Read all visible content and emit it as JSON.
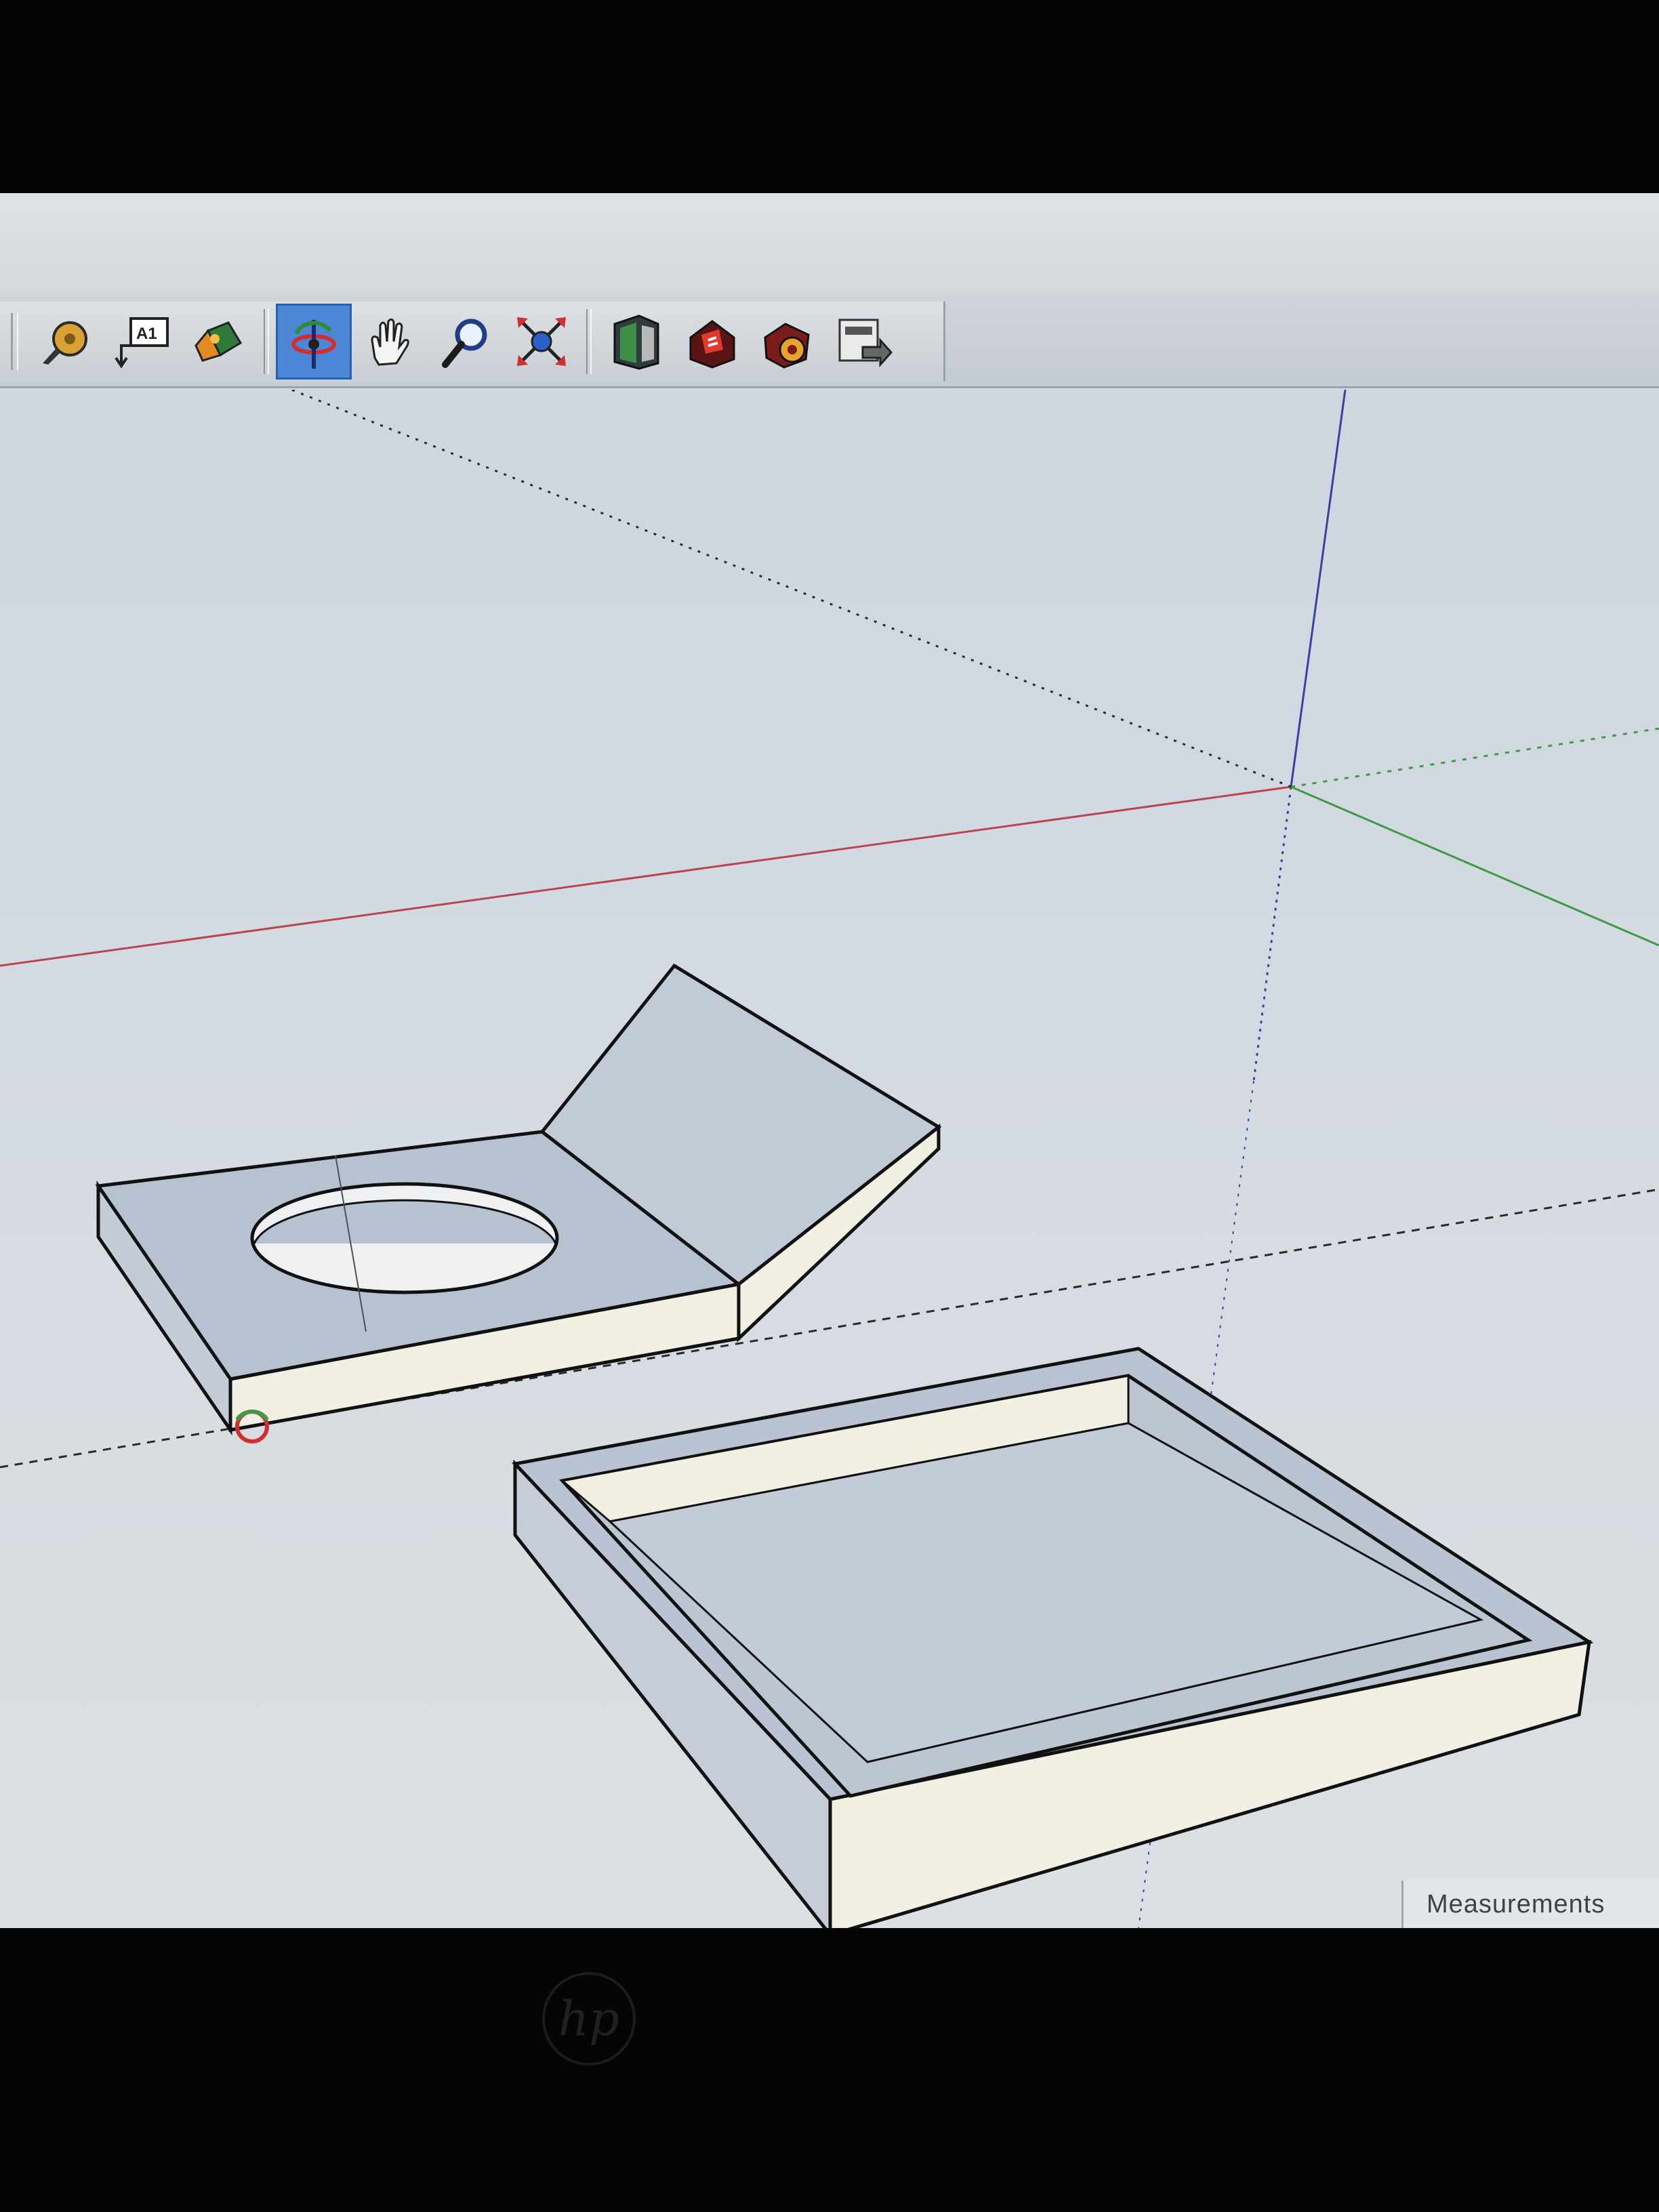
{
  "toolbar": {
    "tools": [
      {
        "icon": "tape-measure-icon",
        "tooltip": ""
      },
      {
        "icon": "text-tool-icon",
        "label": "A1"
      },
      {
        "icon": "paint-bucket-icon"
      },
      {
        "icon": "orbit-icon",
        "active": true
      },
      {
        "icon": "pan-hand-icon"
      },
      {
        "icon": "zoom-icon"
      },
      {
        "icon": "zoom-extents-icon"
      },
      {
        "icon": "warehouse-icon"
      },
      {
        "icon": "share-model-icon"
      },
      {
        "icon": "extension-warehouse-icon"
      },
      {
        "icon": "send-to-layout-icon"
      }
    ],
    "active_color": "#4c86d6"
  },
  "status_bar": {
    "measurements_label": "Measurements"
  },
  "device": {
    "logo_text": "hp"
  },
  "colors": {
    "red_axis": "#b8454f",
    "green_axis": "#3f9a45",
    "blue_axis": "#3a3fa8",
    "face_top": "#b9c3d1",
    "face_side": "#f2efe3"
  }
}
